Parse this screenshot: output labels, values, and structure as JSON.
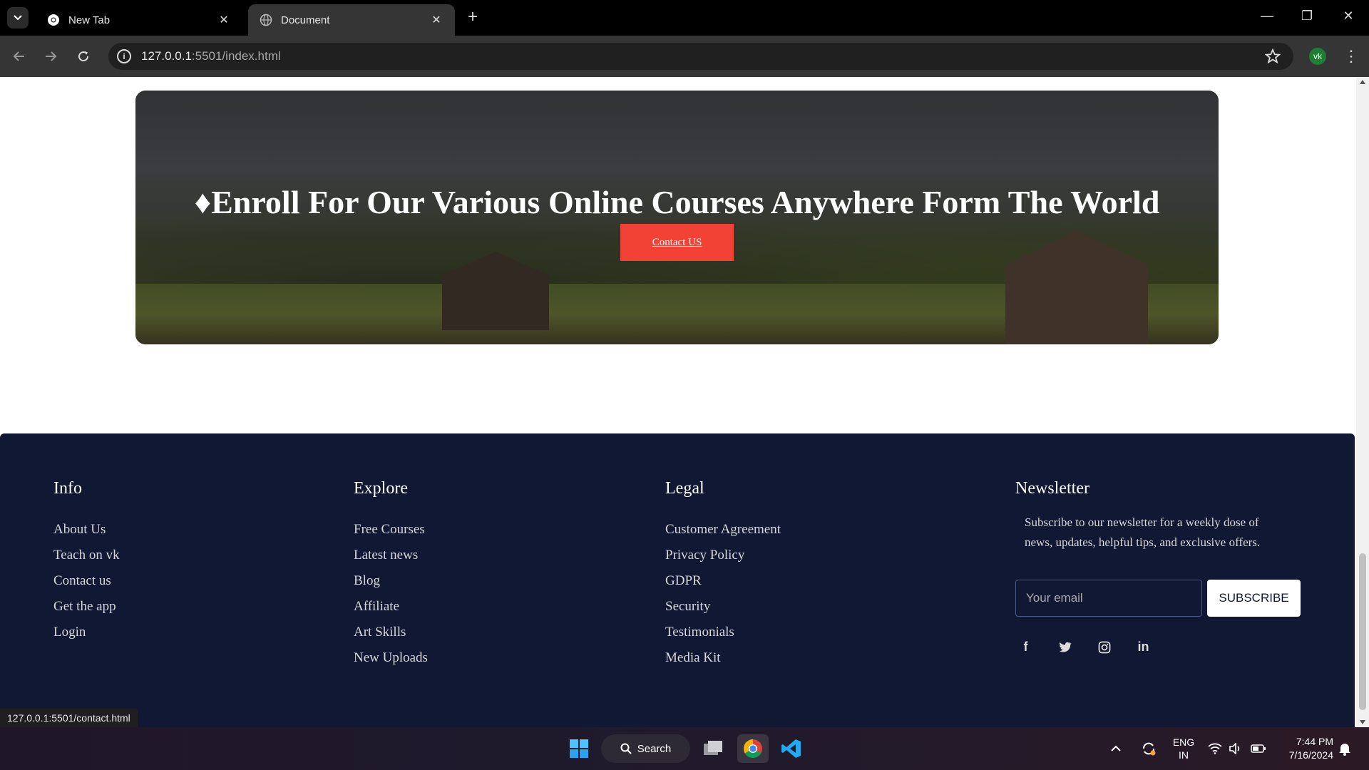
{
  "browser": {
    "tabs": [
      {
        "label": "New Tab",
        "active": false
      },
      {
        "label": "Document",
        "active": true
      }
    ],
    "url_host": "127.0.0.1",
    "url_rest": ":5501/index.html",
    "profile_initials": "vk"
  },
  "hero": {
    "heading": "♦Enroll For Our Various Online Courses Anywhere Form The World",
    "cta_label": "Contact US"
  },
  "footer": {
    "info": {
      "title": "Info",
      "links": [
        "About Us",
        "Teach on vk",
        "Contact us",
        "Get the app",
        "Login"
      ]
    },
    "explore": {
      "title": "Explore",
      "links": [
        "Free Courses",
        "Latest news",
        "Blog",
        "Affiliate",
        "Art Skills",
        "New Uploads"
      ]
    },
    "legal": {
      "title": "Legal",
      "links": [
        "Customer Agreement",
        "Privacy Policy",
        "GDPR",
        "Security",
        "Testimonials",
        "Media Kit"
      ]
    },
    "newsletter": {
      "title": "Newsletter",
      "text": "Subscribe to our newsletter for a weekly dose of news, updates, helpful tips, and exclusive offers.",
      "email_placeholder": "Your email",
      "button_label": "SUBSCRIBE",
      "social_icons": [
        "facebook-icon",
        "twitter-icon",
        "instagram-icon",
        "linkedin-icon"
      ]
    }
  },
  "status_bar": {
    "link": "127.0.0.1:5501/contact.html"
  },
  "taskbar": {
    "search_label": "Search",
    "lang_top": "ENG",
    "lang_bottom": "IN",
    "time": "7:44 PM",
    "date": "7/16/2024"
  },
  "colors": {
    "footer_bg": "#101833",
    "cta_bg": "#f24235",
    "chrome_bg": "#353535"
  }
}
